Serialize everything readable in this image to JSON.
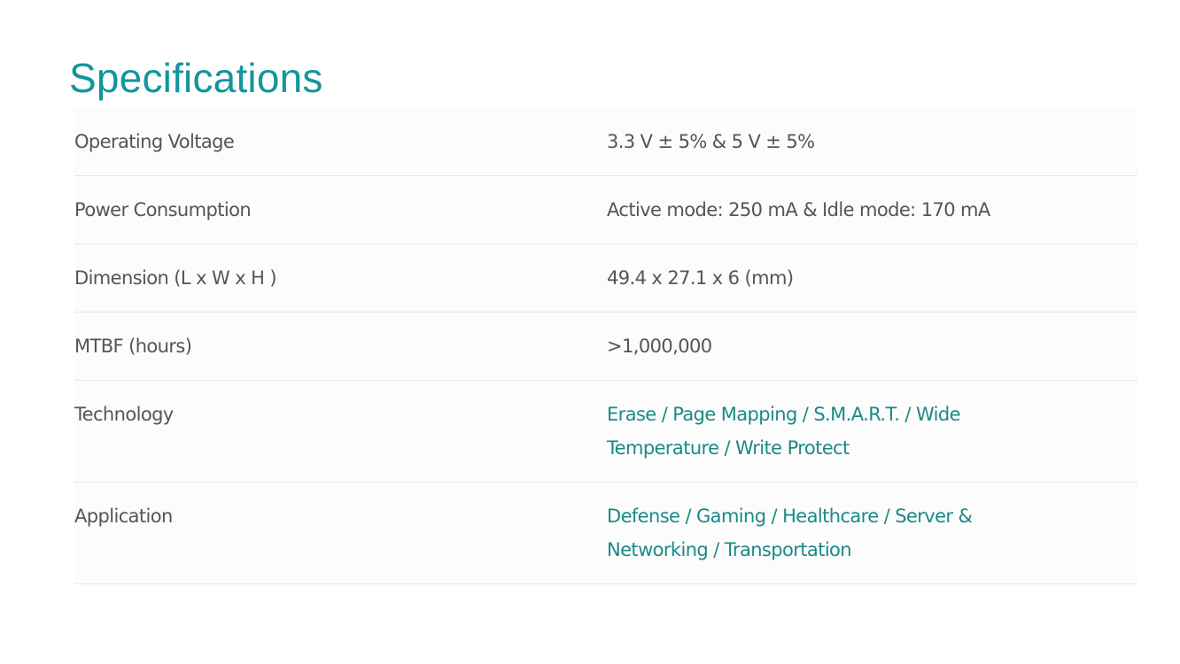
{
  "section": {
    "title": "Specifications"
  },
  "specs": [
    {
      "label": "Operating Voltage",
      "value": "3.3 V ± 5% & 5 V ± 5%"
    },
    {
      "label": "Power Consumption",
      "value": "Active mode: 250 mA & Idle mode: 170 mA"
    },
    {
      "label": "Dimension (L x W x H )",
      "value": "49.4 x 27.1 x 6 (mm)"
    },
    {
      "label": "MTBF (hours)",
      "value": ">1,000,000"
    },
    {
      "label": "Technology",
      "value": "Erase / Page Mapping / S.M.A.R.T. / Wide Temperature / Write Protect"
    },
    {
      "label": "Application",
      "value": "Defense / Gaming / Healthcare / Server & Networking / Transportation"
    }
  ],
  "colors": {
    "title": "#13969b",
    "text": "#555555",
    "link": "#1a8a86",
    "divider": "#e6e6e6"
  }
}
